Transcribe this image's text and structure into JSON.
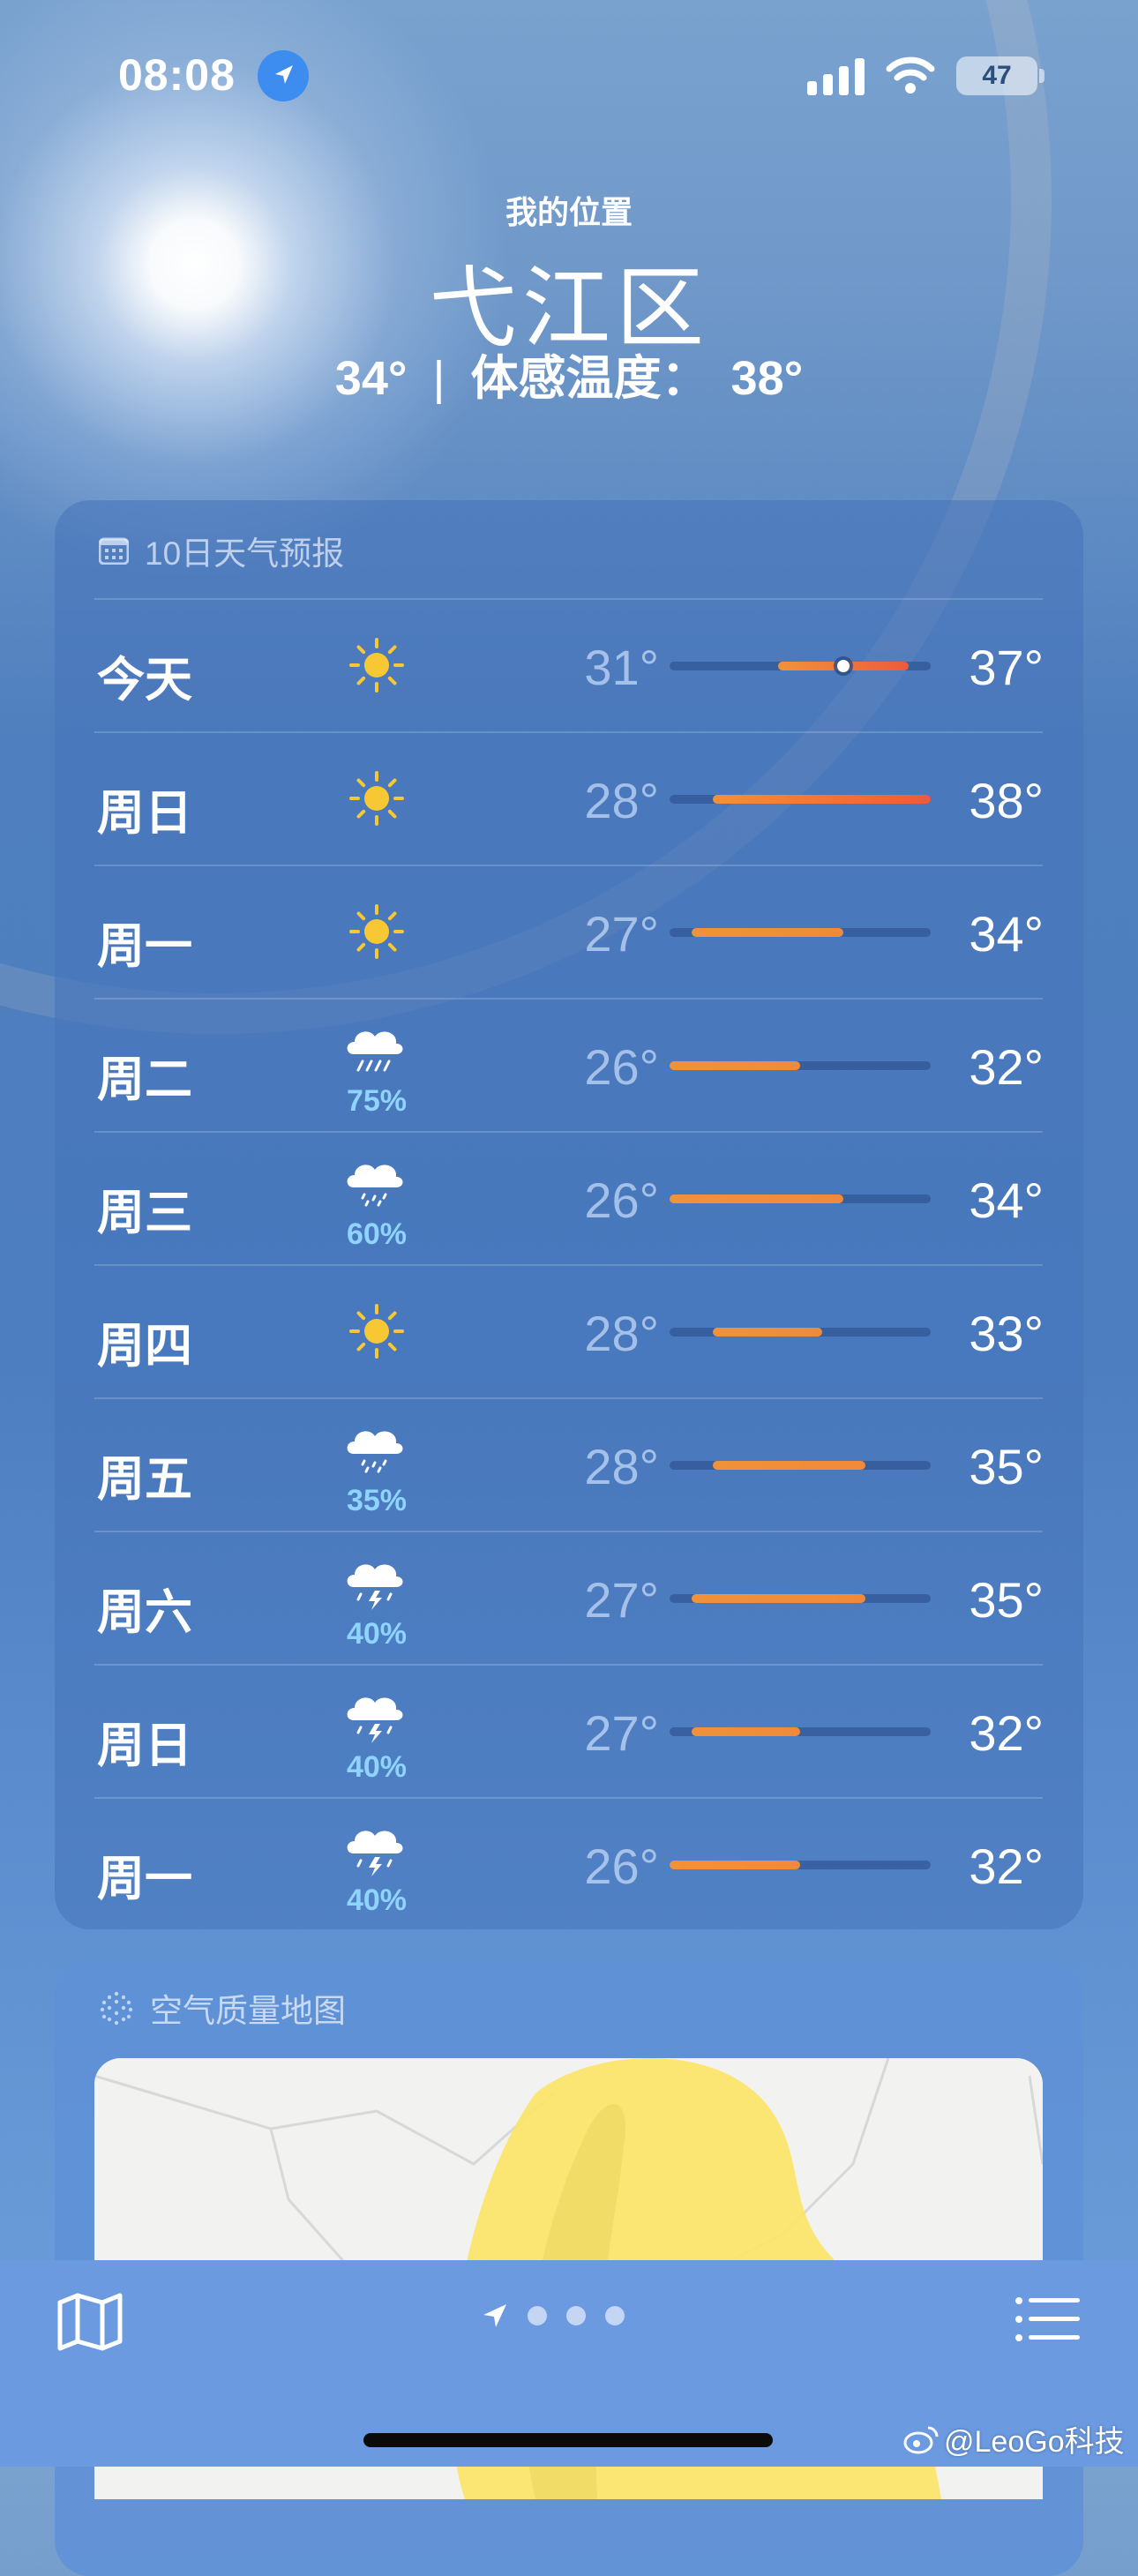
{
  "status_bar": {
    "time": "08:08",
    "battery": "47"
  },
  "header": {
    "location_label": "我的位置",
    "city": "弋江区",
    "current_temp": "34°",
    "feels_like": "体感温度：",
    "feels_like_value": "38°"
  },
  "forecast": {
    "title": "10日天气预报",
    "range_min": 26,
    "range_max": 38,
    "current_temp_value": 34,
    "days": [
      {
        "day": "今天",
        "icon": "sun-icon",
        "precip": "",
        "low": "31°",
        "high": "37°",
        "low_val": 31,
        "high_val": 37
      },
      {
        "day": "周日",
        "icon": "sun-icon",
        "precip": "",
        "low": "28°",
        "high": "38°",
        "low_val": 28,
        "high_val": 38
      },
      {
        "day": "周一",
        "icon": "sun-icon",
        "precip": "",
        "low": "27°",
        "high": "34°",
        "low_val": 27,
        "high_val": 34
      },
      {
        "day": "周二",
        "icon": "rain-cloud-icon",
        "precip": "75%",
        "low": "26°",
        "high": "32°",
        "low_val": 26,
        "high_val": 32
      },
      {
        "day": "周三",
        "icon": "drizzle-cloud-icon",
        "precip": "60%",
        "low": "26°",
        "high": "34°",
        "low_val": 26,
        "high_val": 34
      },
      {
        "day": "周四",
        "icon": "sun-icon",
        "precip": "",
        "low": "28°",
        "high": "33°",
        "low_val": 28,
        "high_val": 33
      },
      {
        "day": "周五",
        "icon": "drizzle-cloud-icon",
        "precip": "35%",
        "low": "28°",
        "high": "35°",
        "low_val": 28,
        "high_val": 35
      },
      {
        "day": "周六",
        "icon": "thunderstorm-cloud-icon",
        "precip": "40%",
        "low": "27°",
        "high": "35°",
        "low_val": 27,
        "high_val": 35
      },
      {
        "day": "周日",
        "icon": "thunderstorm-cloud-icon",
        "precip": "40%",
        "low": "27°",
        "high": "32°",
        "low_val": 27,
        "high_val": 32
      },
      {
        "day": "周一",
        "icon": "thunderstorm-cloud-icon",
        "precip": "40%",
        "low": "26°",
        "high": "32°",
        "low_val": 26,
        "high_val": 32
      }
    ]
  },
  "air_quality": {
    "title": "空气质量地图"
  },
  "watermark": "@LeoGo科技",
  "colors": {
    "orange": "#f0923a",
    "red": "#ef5a3c",
    "precip": "#8fd3ff",
    "sun": "#f7c833"
  }
}
